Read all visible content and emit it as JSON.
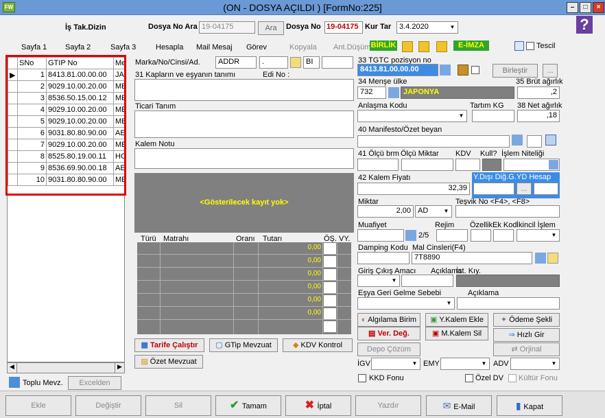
{
  "window": {
    "title": "(ON  - DOSYA AÇILDI ) [FormNo:225]",
    "min": "–",
    "max": "□",
    "close": "×"
  },
  "header": {
    "is_tak": "İş Tak.Dizin",
    "dosya_no_ara_label": "Dosya No Ara",
    "dosya_no_ara_value": "19-04175",
    "ara_button": "Ara",
    "dosya_no_label": "Dosya No",
    "dosya_no_value": "19-04175",
    "kur_tar_label": "Kur Tar",
    "kur_tar_value": "3.4.2020",
    "help": "?"
  },
  "tabs": {
    "sayfa1": "Sayfa 1",
    "sayfa2": "Sayfa 2",
    "sayfa3": "Sayfa 3",
    "hesapla": "Hesapla",
    "mail": "Mail Mesaj",
    "gorev": "Görev",
    "kopyala": "Kopyala",
    "ant_dusum": "Ant.Düşüm",
    "birlik": "BİRLİK",
    "eimza": "E-İMZA",
    "tescil": "Tescil"
  },
  "grid": {
    "columns": [
      "SNo",
      "GTIP No",
      "Me"
    ],
    "rows": [
      {
        "sno": "1",
        "gtip": "8413.81.00.00.00",
        "me": "JA"
      },
      {
        "sno": "2",
        "gtip": "9029.10.00.20.00",
        "me": "ME"
      },
      {
        "sno": "3",
        "gtip": "8536.50.15.00.12",
        "me": "ME"
      },
      {
        "sno": "4",
        "gtip": "9029.10.00.20.00",
        "me": "ME"
      },
      {
        "sno": "5",
        "gtip": "9029.10.00.20.00",
        "me": "ME"
      },
      {
        "sno": "6",
        "gtip": "9031.80.80.90.00",
        "me": "AE"
      },
      {
        "sno": "7",
        "gtip": "9029.10.00.20.00",
        "me": "ME"
      },
      {
        "sno": "8",
        "gtip": "8525.80.19.00.11",
        "me": "HO"
      },
      {
        "sno": "9",
        "gtip": "8536.69.90.00.18",
        "me": "AE"
      },
      {
        "sno": "10",
        "gtip": "9031.80.80.90.00",
        "me": "ME"
      }
    ]
  },
  "left_bottom": {
    "toplu": "Toplu Mevz.",
    "excel": "Excelden"
  },
  "mid": {
    "marka_label": "Marka/No/Cinsi/Ad.",
    "marka_value": "ADDR",
    "dot_value": ".",
    "bi_value": "BI",
    "kaplar_label": "31 Kapların ve eşyanın tanımı",
    "edi_label": "Edi No :",
    "ticari_label": "Ticari Tanım",
    "kalem_notu_label": "Kalem Notu",
    "no_records": "<Gösterilecek kayıt yok>",
    "tax_cols": [
      "Türü",
      "Matrahı",
      "Oranı",
      "Tutarı",
      "ÖŞ.",
      "VY."
    ],
    "tax_vals": [
      "0,00",
      "0,00",
      "0,00",
      "0,00",
      "0,00",
      "0,00"
    ],
    "tarife": "Tarife Çalıştır",
    "gtip_mevzuat": "GTip Mevzuat",
    "kdv_kontrol": "KDV Kontrol",
    "ozet_mevzuat": "Özet Mevzuat"
  },
  "right": {
    "tgtc_label": "33 TGTC pozisyon no",
    "tgtc_value": "8413.81.00.00.00",
    "birlestir": "Birleştir",
    "dots": "...",
    "mense_label": "34 Menşe ülke",
    "mense_code": "732",
    "mense_name": "JAPONYA",
    "brut_label": "35 Brüt ağırlık",
    "brut_value": ",2",
    "anlasma_label": "Anlaşma Kodu",
    "tartim_label": "Tartım KG",
    "net_label": "38 Net ağırlık",
    "net_value": ",18",
    "manifesto_label": "40 Manifesto/Özet beyan",
    "olcu_label": "41 Ölçü brm",
    "olcu_miktar_label": "Ölçü Miktar",
    "kdv_label": "KDV",
    "kull_label": "Kull?",
    "islem_label": "İşlem Niteliği",
    "kalem_fiyat_label": "42 Kalem Fiyatı",
    "kalem_fiyat_value": "32,39",
    "ydisi_label": "Y.Dışı Diğ.G.",
    "yd_hesap_label": "YD Hesap",
    "miktar_label": "Miktar",
    "miktar_value": "2,00",
    "miktar_unit": "AD",
    "tesvik_label": "Teşvik No <F4>, <F8>",
    "muafiyet_label": "Muafiyet",
    "rejim_label": "Rejim",
    "ozellik_label": "Özellik",
    "ek_kod_label": "Ek Kod",
    "ikincil_label": "İkincil İşlem",
    "counter": "2/5",
    "damping_label": "Damping Kodu",
    "mal_cinsleri_label": "Mal Cinsleri(F4)",
    "mal_value": "7T8890",
    "giris_label": "Giriş Çıkış Amacı",
    "aciklama_label": "Açıklama",
    "ist_label": "İst. Kıy.",
    "esya_label": "Eşya Geri Gelme Sebebi",
    "aciklama2_label": "Açıklama",
    "algilama": "Algılama Birim",
    "ykalem": "Y.Kalem Ekle",
    "odeme": "Ödeme Şekli",
    "verdeg": "Ver. Değ.",
    "mkalem": "M.Kalem Sil",
    "hizli": "Hızlı Gir",
    "depo": "Depo Çözüm",
    "orjinal": "Orjinal",
    "igv": "İGV",
    "emy": "EMY",
    "adv": "ADV",
    "kkd": "KKD Fonu",
    "ozel_dv": "Özel DV",
    "kultur": "Kültür Fonu"
  },
  "footer": {
    "ekle": "Ekle",
    "degistir": "Değiştir",
    "sil": "Sil",
    "tamam": "Tamam",
    "iptal": "İptal",
    "yazdir": "Yazdır",
    "email": "E-Mail",
    "kapat": "Kapat"
  }
}
